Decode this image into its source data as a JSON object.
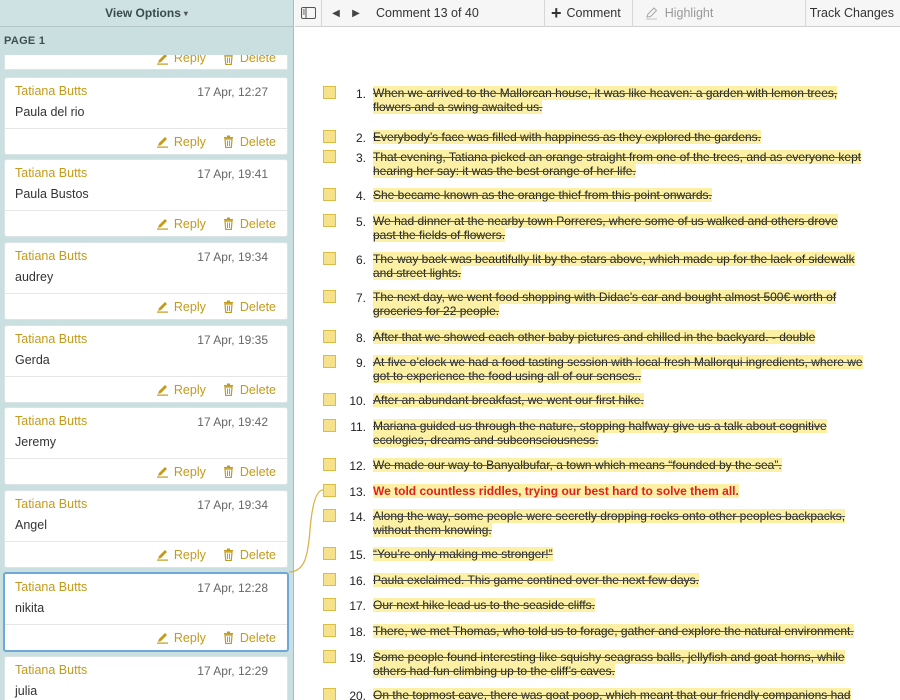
{
  "sidebar": {
    "view_options_label": "View Options",
    "view_options_caret": "▾",
    "page_label": "PAGE 1",
    "partial_top": {
      "reply_label": "Reply",
      "delete_label": "Delete"
    },
    "comments": [
      {
        "author": "Tatiana Butts",
        "date": "17 Apr, 12:27",
        "body": "Paula del rio",
        "reply_label": "Reply",
        "delete_label": "Delete"
      },
      {
        "author": "Tatiana Butts",
        "date": "17 Apr, 19:41",
        "body": "Paula Bustos",
        "reply_label": "Reply",
        "delete_label": "Delete"
      },
      {
        "author": "Tatiana Butts",
        "date": "17 Apr, 19:34",
        "body": "audrey",
        "reply_label": "Reply",
        "delete_label": "Delete"
      },
      {
        "author": "Tatiana Butts",
        "date": "17 Apr, 19:35",
        "body": "Gerda",
        "reply_label": "Reply",
        "delete_label": "Delete"
      },
      {
        "author": "Tatiana Butts",
        "date": "17 Apr, 19:42",
        "body": "Jeremy",
        "reply_label": "Reply",
        "delete_label": "Delete"
      },
      {
        "author": "Tatiana Butts",
        "date": "17 Apr, 19:34",
        "body": "Angel",
        "reply_label": "Reply",
        "delete_label": "Delete"
      },
      {
        "author": "Tatiana Butts",
        "date": "17 Apr, 12:28",
        "body": "nikita",
        "reply_label": "Reply",
        "delete_label": "Delete",
        "selected": true
      },
      {
        "author": "Tatiana Butts",
        "date": "17 Apr, 12:29",
        "body": "julia",
        "reply_label": "Reply",
        "delete_label": "Delete"
      }
    ]
  },
  "toolbar": {
    "sidebar_toggle_icon": "sidebar-icon",
    "prev_icon": "◀",
    "next_icon": "▶",
    "counter": "Comment 13 of 40",
    "add_comment_icon": "+",
    "add_comment_label": "Comment",
    "highlight_label": "Highlight",
    "track_changes_label": "Track Changes"
  },
  "document": {
    "items": [
      {
        "num": "1.",
        "text": "When we arrived to the Mallorcan house, it was like heaven:   a garden with lemon trees, flowers and a swing awaited us."
      },
      {
        "num": "2.",
        "text": "Everybody’s face was filled with happiness as they explored the gardens. "
      },
      {
        "num": "3.",
        "text": "That evening, Tatiana picked an orange straight from one of the trees, and as everyone kept hearing her say: it was the best orange of her life. "
      },
      {
        "num": "4.",
        "text": "She became known as the orange thief from this point onwards. "
      },
      {
        "num": "5.",
        "text": "We had dinner at the nearby town Porreres, where some of us walked and others drove past the fields of flowers. "
      },
      {
        "num": "6.",
        "text": "The way back was beautifully lit by the stars above, which made up for the lack of sidewalk and street lights."
      },
      {
        "num": "7.",
        "text": "The next day, we went food shopping with Didac’s car and bought almost 500€ worth of groceries for 22 people. "
      },
      {
        "num": "8.",
        "text": "After that we showed each other baby pictures and chilled in the backyard. - double"
      },
      {
        "num": "9.",
        "text": "At five o’clock we had a food tasting session with local fresh Mallorqui ingredients, where we got to experience the food using all of our senses.."
      },
      {
        "num": "10.",
        "text": "After an abundant breakfast, we went our first hike."
      },
      {
        "num": "11.",
        "text": "Mariana guided us through the nature, stopping halfway give us a talk about cognitive ecologies, dreams and subconsciousness. "
      },
      {
        "num": "12.",
        "text": "We made our way to Banyalbufar, a town which means “founded by the sea”."
      },
      {
        "num": "13.",
        "text": "We told countless riddles, trying our best hard to solve them all.",
        "active": true
      },
      {
        "num": "14.",
        "text": "Along the way, some people were secretly dropping rocks onto other peoples backpacks, without them knowing. "
      },
      {
        "num": "15.",
        "text": "“You’re only making me stronger!” "
      },
      {
        "num": "16.",
        "text": "Paula exclaimed. This game contined over the next few days."
      },
      {
        "num": "17.",
        "text": "Our next hike lead us to the seaside cliffs. "
      },
      {
        "num": "18.",
        "text": "There, we met Thomas, who told us to forage, gather and explore the natural environment. "
      },
      {
        "num": "19.",
        "text": "Some people found interesting like squishy seagrass balls, jellyfish and goat horns, while others had fun climbing up to the cliff’s caves. "
      },
      {
        "num": "20.",
        "text": "On the topmost cave, there was goat poop, which meant that our friendly companions had"
      }
    ]
  },
  "colors": {
    "author": "#c49a1a",
    "highlight": "#fbf0a4",
    "active_text": "#e02020",
    "selected_border": "#6ea7d8",
    "sidebar_bg": "#c9dfe0"
  }
}
